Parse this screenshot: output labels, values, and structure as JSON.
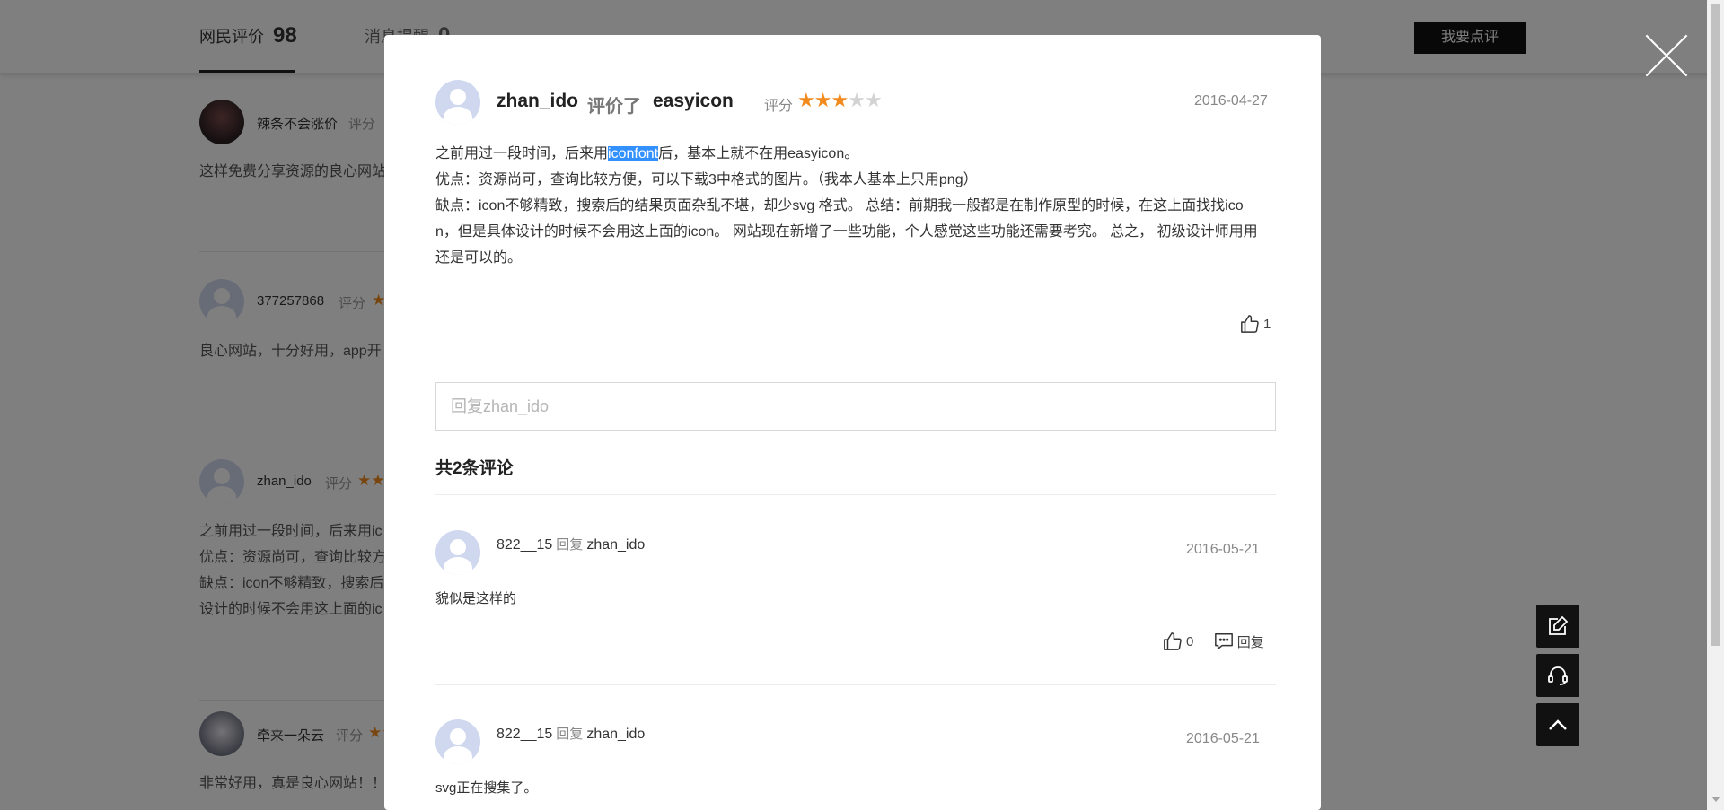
{
  "background": {
    "tabs": [
      {
        "label": "网民评价",
        "count": "98"
      },
      {
        "label": "消息提醒",
        "count": "0"
      }
    ],
    "review_button": "我要点评",
    "items": [
      {
        "name": "辣条不会涨价",
        "score_label": "评分",
        "text": [
          "这样免费分享资源的良心网站"
        ]
      },
      {
        "name": "377257868",
        "score_label": "评分",
        "text": [
          "良心网站，十分好用，app开"
        ]
      },
      {
        "name": "zhan_ido",
        "score_label": "评分",
        "text": [
          "之前用过一段时间，后来用ic",
          "优点：资源尚可，查询比较方",
          "缺点：icon不够精致，搜索后",
          "设计的时候不会用这上面的ic"
        ]
      },
      {
        "name": "牵来一朵云",
        "score_label": "评分",
        "text": [
          "非常好用，真是良心网站！！"
        ]
      }
    ]
  },
  "modal": {
    "author": "zhan_ido",
    "verb": "评价了",
    "target": "easyicon",
    "score_label": "评分",
    "rating": 3,
    "rating_max": 5,
    "date": "2016-04-27",
    "body": {
      "line1_before": "之前用过一段时间，后来用",
      "line1_selected": "iconfont",
      "line1_after": "后，基本上就不在用easyicon。",
      "line2": "优点：资源尚可，查询比较方便，可以下载3中格式的图片。（我本人基本上只用png）",
      "line3": "缺点：icon不够精致，搜索后的结果页面杂乱不堪，却少svg 格式。 总结：前期我一般都是在制作原型的时候，在这上面找找ico",
      "line4": "n，但是具体设计的时候不会用这上面的icon。 网站现在新增了一些功能，个人感觉这些功能还需要考究。 总之， 初级设计师用用",
      "line5": "还是可以的。"
    },
    "like_count": "1",
    "reply_placeholder": "回复zhan_ido",
    "comments_title": "共2条评论",
    "comments": [
      {
        "user": "822__15",
        "reply_word": "回复",
        "to": "zhan_ido",
        "date": "2016-05-21",
        "text": "貌似是这样的",
        "likes": "0",
        "reply_label": "回复"
      },
      {
        "user": "822__15",
        "reply_word": "回复",
        "to": "zhan_ido",
        "date": "2016-05-21",
        "text": "svg正在搜集了。"
      }
    ]
  },
  "floating_buttons": [
    "edit-icon",
    "headset-icon",
    "arrow-up-icon"
  ]
}
